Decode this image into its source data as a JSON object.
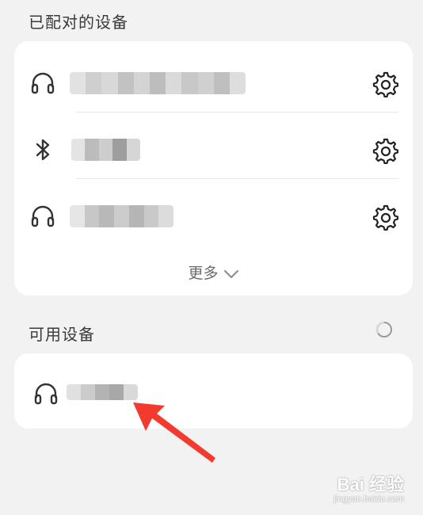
{
  "sections": {
    "paired_title": "已配对的设备",
    "available_title": "可用设备"
  },
  "paired_devices": [
    {
      "icon": "headphones-icon",
      "name_redacted": true
    },
    {
      "icon": "bluetooth-icon",
      "name_redacted": true
    },
    {
      "icon": "headphones-icon",
      "name_redacted": true
    }
  ],
  "more_button": {
    "label": "更多"
  },
  "available_devices": [
    {
      "icon": "headphones-icon",
      "name_redacted": true
    }
  ],
  "watermark": {
    "logo": "Bai 经验",
    "url": "jingyan.baidu.com"
  },
  "colors": {
    "background": "#f2f2f2",
    "card": "#ffffff",
    "arrow": "#f23b2e",
    "redaction": "#c4c4c4"
  }
}
